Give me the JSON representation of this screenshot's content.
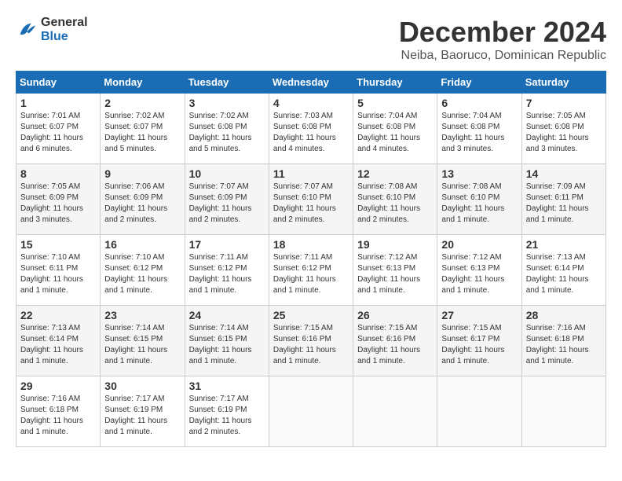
{
  "logo": {
    "line1": "General",
    "line2": "Blue"
  },
  "title": "December 2024",
  "location": "Neiba, Baoruco, Dominican Republic",
  "days_of_week": [
    "Sunday",
    "Monday",
    "Tuesday",
    "Wednesday",
    "Thursday",
    "Friday",
    "Saturday"
  ],
  "weeks": [
    [
      {
        "day": "1",
        "info": "Sunrise: 7:01 AM\nSunset: 6:07 PM\nDaylight: 11 hours\nand 6 minutes."
      },
      {
        "day": "2",
        "info": "Sunrise: 7:02 AM\nSunset: 6:07 PM\nDaylight: 11 hours\nand 5 minutes."
      },
      {
        "day": "3",
        "info": "Sunrise: 7:02 AM\nSunset: 6:08 PM\nDaylight: 11 hours\nand 5 minutes."
      },
      {
        "day": "4",
        "info": "Sunrise: 7:03 AM\nSunset: 6:08 PM\nDaylight: 11 hours\nand 4 minutes."
      },
      {
        "day": "5",
        "info": "Sunrise: 7:04 AM\nSunset: 6:08 PM\nDaylight: 11 hours\nand 4 minutes."
      },
      {
        "day": "6",
        "info": "Sunrise: 7:04 AM\nSunset: 6:08 PM\nDaylight: 11 hours\nand 3 minutes."
      },
      {
        "day": "7",
        "info": "Sunrise: 7:05 AM\nSunset: 6:08 PM\nDaylight: 11 hours\nand 3 minutes."
      }
    ],
    [
      {
        "day": "8",
        "info": "Sunrise: 7:05 AM\nSunset: 6:09 PM\nDaylight: 11 hours\nand 3 minutes."
      },
      {
        "day": "9",
        "info": "Sunrise: 7:06 AM\nSunset: 6:09 PM\nDaylight: 11 hours\nand 2 minutes."
      },
      {
        "day": "10",
        "info": "Sunrise: 7:07 AM\nSunset: 6:09 PM\nDaylight: 11 hours\nand 2 minutes."
      },
      {
        "day": "11",
        "info": "Sunrise: 7:07 AM\nSunset: 6:10 PM\nDaylight: 11 hours\nand 2 minutes."
      },
      {
        "day": "12",
        "info": "Sunrise: 7:08 AM\nSunset: 6:10 PM\nDaylight: 11 hours\nand 2 minutes."
      },
      {
        "day": "13",
        "info": "Sunrise: 7:08 AM\nSunset: 6:10 PM\nDaylight: 11 hours\nand 1 minute."
      },
      {
        "day": "14",
        "info": "Sunrise: 7:09 AM\nSunset: 6:11 PM\nDaylight: 11 hours\nand 1 minute."
      }
    ],
    [
      {
        "day": "15",
        "info": "Sunrise: 7:10 AM\nSunset: 6:11 PM\nDaylight: 11 hours\nand 1 minute."
      },
      {
        "day": "16",
        "info": "Sunrise: 7:10 AM\nSunset: 6:12 PM\nDaylight: 11 hours\nand 1 minute."
      },
      {
        "day": "17",
        "info": "Sunrise: 7:11 AM\nSunset: 6:12 PM\nDaylight: 11 hours\nand 1 minute."
      },
      {
        "day": "18",
        "info": "Sunrise: 7:11 AM\nSunset: 6:12 PM\nDaylight: 11 hours\nand 1 minute."
      },
      {
        "day": "19",
        "info": "Sunrise: 7:12 AM\nSunset: 6:13 PM\nDaylight: 11 hours\nand 1 minute."
      },
      {
        "day": "20",
        "info": "Sunrise: 7:12 AM\nSunset: 6:13 PM\nDaylight: 11 hours\nand 1 minute."
      },
      {
        "day": "21",
        "info": "Sunrise: 7:13 AM\nSunset: 6:14 PM\nDaylight: 11 hours\nand 1 minute."
      }
    ],
    [
      {
        "day": "22",
        "info": "Sunrise: 7:13 AM\nSunset: 6:14 PM\nDaylight: 11 hours\nand 1 minute."
      },
      {
        "day": "23",
        "info": "Sunrise: 7:14 AM\nSunset: 6:15 PM\nDaylight: 11 hours\nand 1 minute."
      },
      {
        "day": "24",
        "info": "Sunrise: 7:14 AM\nSunset: 6:15 PM\nDaylight: 11 hours\nand 1 minute."
      },
      {
        "day": "25",
        "info": "Sunrise: 7:15 AM\nSunset: 6:16 PM\nDaylight: 11 hours\nand 1 minute."
      },
      {
        "day": "26",
        "info": "Sunrise: 7:15 AM\nSunset: 6:16 PM\nDaylight: 11 hours\nand 1 minute."
      },
      {
        "day": "27",
        "info": "Sunrise: 7:15 AM\nSunset: 6:17 PM\nDaylight: 11 hours\nand 1 minute."
      },
      {
        "day": "28",
        "info": "Sunrise: 7:16 AM\nSunset: 6:18 PM\nDaylight: 11 hours\nand 1 minute."
      }
    ],
    [
      {
        "day": "29",
        "info": "Sunrise: 7:16 AM\nSunset: 6:18 PM\nDaylight: 11 hours\nand 1 minute."
      },
      {
        "day": "30",
        "info": "Sunrise: 7:17 AM\nSunset: 6:19 PM\nDaylight: 11 hours\nand 1 minute."
      },
      {
        "day": "31",
        "info": "Sunrise: 7:17 AM\nSunset: 6:19 PM\nDaylight: 11 hours\nand 2 minutes."
      },
      {
        "day": "",
        "info": ""
      },
      {
        "day": "",
        "info": ""
      },
      {
        "day": "",
        "info": ""
      },
      {
        "day": "",
        "info": ""
      }
    ]
  ]
}
